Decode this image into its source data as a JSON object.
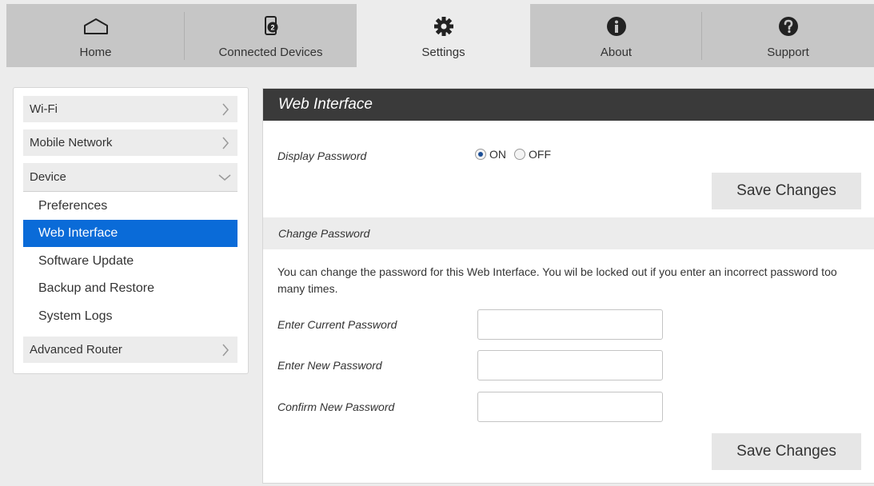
{
  "nav": {
    "tabs": [
      {
        "label": "Home",
        "icon": "home-icon"
      },
      {
        "label": "Connected Devices",
        "icon": "connected-devices-icon",
        "badge": "2"
      },
      {
        "label": "Settings",
        "icon": "gear-icon",
        "active": true
      },
      {
        "label": "About",
        "icon": "info-icon"
      },
      {
        "label": "Support",
        "icon": "help-icon"
      }
    ]
  },
  "sidebar": {
    "items": [
      {
        "label": "Wi-Fi"
      },
      {
        "label": "Mobile Network"
      },
      {
        "label": "Device"
      },
      {
        "label": "Advanced Router"
      }
    ],
    "device_subitems": [
      {
        "label": "Preferences"
      },
      {
        "label": "Web Interface",
        "active": true
      },
      {
        "label": "Software Update"
      },
      {
        "label": "Backup and Restore"
      },
      {
        "label": "System Logs"
      }
    ]
  },
  "main": {
    "title": "Web Interface",
    "display_password": {
      "label": "Display Password",
      "on_label": "ON",
      "off_label": "OFF",
      "selected": "ON"
    },
    "save_label": "Save Changes",
    "change_password": {
      "section_title": "Change Password",
      "description": "You can change the password for this Web Interface. You wil be locked out if you enter an incorrect password too many times.",
      "current_label": "Enter Current Password",
      "new_label": "Enter New Password",
      "confirm_label": "Confirm New Password",
      "current_value": "",
      "new_value": "",
      "confirm_value": ""
    }
  },
  "colors": {
    "active_blue": "#0a6bd8",
    "header_dark": "#3a3a3a",
    "nav_gray": "#c6c6c6"
  }
}
